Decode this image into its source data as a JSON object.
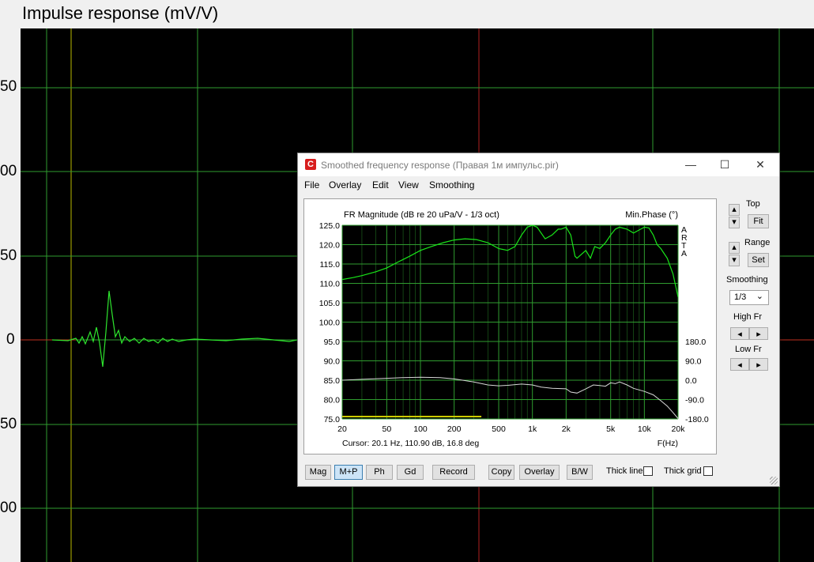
{
  "background": {
    "title": "Impulse response (mV/V)",
    "y_ticks": [
      "50",
      "00",
      "50",
      "0",
      "50",
      "00"
    ]
  },
  "window": {
    "title": "Smoothed frequency response (Правая 1м импульс.pir)",
    "controls": {
      "minimize": "—",
      "maximize": "☐",
      "close": "✕"
    },
    "menu": [
      "File",
      "Overlay",
      "Edit",
      "View",
      "Smoothing"
    ]
  },
  "chart_data": {
    "type": "line",
    "title": "FR Magnitude (dB re 20 uPa/V - 1/3 oct)",
    "right_title": "Min.Phase (°)",
    "watermark": [
      "A",
      "R",
      "T",
      "A"
    ],
    "x_scale": "log",
    "xlim": [
      20,
      20000
    ],
    "x_ticks": [
      {
        "v": 20,
        "label": "20"
      },
      {
        "v": 50,
        "label": "50"
      },
      {
        "v": 100,
        "label": "100"
      },
      {
        "v": 200,
        "label": "200"
      },
      {
        "v": 500,
        "label": "500"
      },
      {
        "v": 1000,
        "label": "1k"
      },
      {
        "v": 2000,
        "label": "2k"
      },
      {
        "v": 5000,
        "label": "5k"
      },
      {
        "v": 10000,
        "label": "10k"
      },
      {
        "v": 20000,
        "label": "20k"
      }
    ],
    "xlabel": "F(Hz)",
    "ylim": [
      75,
      125
    ],
    "y_ticks": [
      "75.0",
      "80.0",
      "85.0",
      "90.0",
      "95.0",
      "100.0",
      "105.0",
      "110.0",
      "115.0",
      "120.0",
      "125.0"
    ],
    "phase_ylim": [
      -180,
      180
    ],
    "phase_ticks": [
      "-180.0",
      "-90.0",
      "0.0",
      "90.0",
      "180.0"
    ],
    "cursor_text": "Cursor: 20.1 Hz, 110.90 dB, 16.8 deg",
    "colors": {
      "magnitude": "#19e619",
      "phase": "#d8d8d8",
      "grid": "#2f9c2f",
      "marker": "#cccc00"
    },
    "series": [
      {
        "x": [
          20,
          25,
          30,
          40,
          50,
          63,
          80,
          100,
          125,
          160,
          200,
          250,
          315,
          400,
          500,
          600,
          700,
          800,
          900,
          1000,
          1100,
          1300,
          1500,
          1700,
          1800,
          2000,
          2200,
          2400,
          2500,
          3000,
          3300,
          3600,
          4000,
          4500,
          5000,
          5500,
          6000,
          7000,
          8000,
          9000,
          10000,
          11000,
          12000,
          13000,
          14000,
          16000,
          18000,
          20000
        ],
        "values": [
          111.0,
          111.5,
          112.0,
          113.0,
          114.0,
          115.5,
          117.0,
          118.5,
          119.5,
          120.5,
          121.2,
          121.5,
          121.3,
          120.5,
          119.0,
          118.5,
          119.5,
          122.5,
          124.5,
          125.0,
          124.5,
          121.5,
          122.5,
          124.0,
          124.0,
          124.5,
          122.5,
          117.0,
          116.5,
          118.5,
          116.5,
          119.5,
          119.0,
          120.5,
          122.5,
          124.0,
          124.5,
          124.0,
          123.0,
          123.8,
          124.5,
          124.3,
          122.5,
          120.0,
          119.0,
          116.5,
          112.5,
          106.5
        ]
      },
      {
        "x": [
          20,
          30,
          50,
          70,
          100,
          150,
          200,
          300,
          400,
          500,
          600,
          800,
          1000,
          1200,
          1500,
          2000,
          2200,
          2500,
          3000,
          3500,
          4000,
          4500,
          5000,
          5500,
          6000,
          7000,
          8000,
          10000,
          12000,
          14000,
          16000,
          18000,
          20000
        ],
        "values": [
          0,
          4,
          9,
          12,
          14,
          12,
          6,
          -8,
          -22,
          -26,
          -24,
          -18,
          -22,
          -32,
          -38,
          -40,
          -55,
          -60,
          -40,
          -22,
          -25,
          -28,
          -12,
          -16,
          -8,
          -22,
          -38,
          -52,
          -68,
          -95,
          -120,
          -150,
          -178
        ]
      }
    ]
  },
  "side_panel": {
    "top_label": "Top",
    "fit_label": "Fit",
    "range_label": "Range",
    "set_label": "Set",
    "smoothing_label": "Smoothing",
    "smoothing_value": "1/3",
    "high_fr_label": "High Fr",
    "low_fr_label": "Low Fr",
    "up_arrow": "▴",
    "down_arrow": "▾",
    "left_arrow": "◂",
    "right_arrow": "▸",
    "dropdown_arrow": "⌄"
  },
  "bottom_bar": {
    "mag": "Mag",
    "mp": "M+P",
    "ph": "Ph",
    "gd": "Gd",
    "record": "Record",
    "copy": "Copy",
    "overlay": "Overlay",
    "bw": "B/W",
    "thick_line": "Thick line",
    "thick_grid": "Thick grid"
  }
}
